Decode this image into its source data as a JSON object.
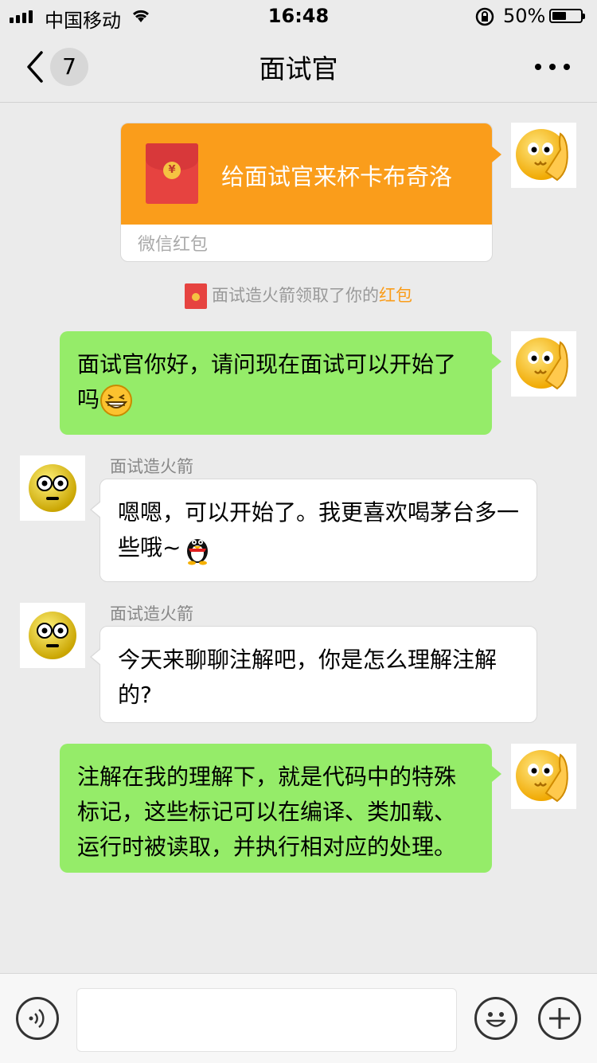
{
  "status_bar": {
    "carrier": "中国移动",
    "time": "16:48",
    "battery_percent": "50%",
    "battery_level": 0.5
  },
  "nav": {
    "unread_count": "7",
    "title": "面试官"
  },
  "red_packet": {
    "message": "给面试官来杯卡布奇洛",
    "label": "微信红包",
    "coin_symbol": "¥"
  },
  "notice": {
    "text": "面试造火箭领取了你的",
    "highlight": "红包"
  },
  "messages": [
    {
      "side": "right",
      "text": "面试官你好，请问现在面试可以开始了吗",
      "emoji": "grin-emoji"
    },
    {
      "side": "left",
      "sender": "面试造火箭",
      "text": "嗯嗯，可以开始了。我更喜欢喝茅台多一些哦~",
      "emoji": "penguin-emoji"
    },
    {
      "side": "left",
      "sender": "面试造火箭",
      "text": "今天来聊聊注解吧，你是怎么理解注解的?"
    },
    {
      "side": "right",
      "text": "注解在我的理解下，就是代码中的特殊标记，这些标记可以在编译、类加载、运行时被读取，并执行相对应的处理。"
    }
  ],
  "colors": {
    "background": "#ebebeb",
    "my_bubble": "#95ec69",
    "their_bubble": "#ffffff",
    "red_packet": "#fa9d1b",
    "highlight": "#fa9d1b"
  },
  "input": {
    "value": ""
  }
}
